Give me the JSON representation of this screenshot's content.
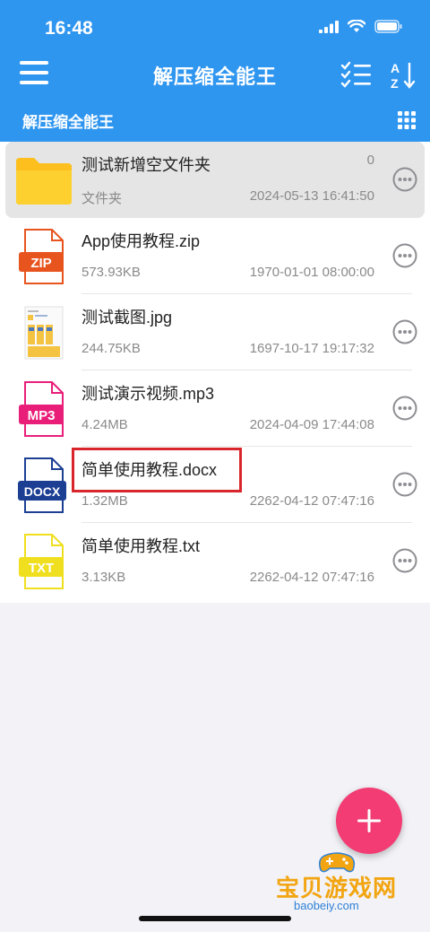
{
  "status_bar": {
    "time": "16:48"
  },
  "app_bar": {
    "title": "解压缩全能王"
  },
  "path_bar": {
    "current": "解压缩全能王"
  },
  "files": [
    {
      "name": "测试新增空文件夹",
      "meta": "文件夹",
      "date": "2024-05-13 16:41:50",
      "count": "0",
      "type": "folder",
      "icon": "folder-icon"
    },
    {
      "name": "App使用教程.zip",
      "meta": "573.93KB",
      "date": "1970-01-01 08:00:00",
      "type": "zip",
      "badge": "ZIP",
      "color": "#e8541e",
      "icon": "zip-file-icon"
    },
    {
      "name": "测试截图.jpg",
      "meta": "244.75KB",
      "date": "1697-10-17 19:17:32",
      "type": "image",
      "icon": "image-thumbnail"
    },
    {
      "name": "测试演示视频.mp3",
      "meta": "4.24MB",
      "date": "2024-04-09 17:44:08",
      "type": "mp3",
      "badge": "MP3",
      "color": "#e91e78",
      "icon": "mp3-file-icon"
    },
    {
      "name": "简单使用教程.docx",
      "meta": "1.32MB",
      "date": "2262-04-12 07:47:16",
      "type": "docx",
      "badge": "DOCX",
      "color": "#1c3f94",
      "icon": "docx-file-icon"
    },
    {
      "name": "简单使用教程.txt",
      "meta": "3.13KB",
      "date": "2262-04-12 07:47:16",
      "type": "txt",
      "badge": "TXT",
      "color": "#f0df1e",
      "icon": "txt-file-icon"
    }
  ],
  "watermark": {
    "text": "宝贝游戏网",
    "sub": "baobeiy.com"
  },
  "colors": {
    "primary": "#2f96f0",
    "fab": "#f23c73",
    "highlight": "#d9262d"
  }
}
